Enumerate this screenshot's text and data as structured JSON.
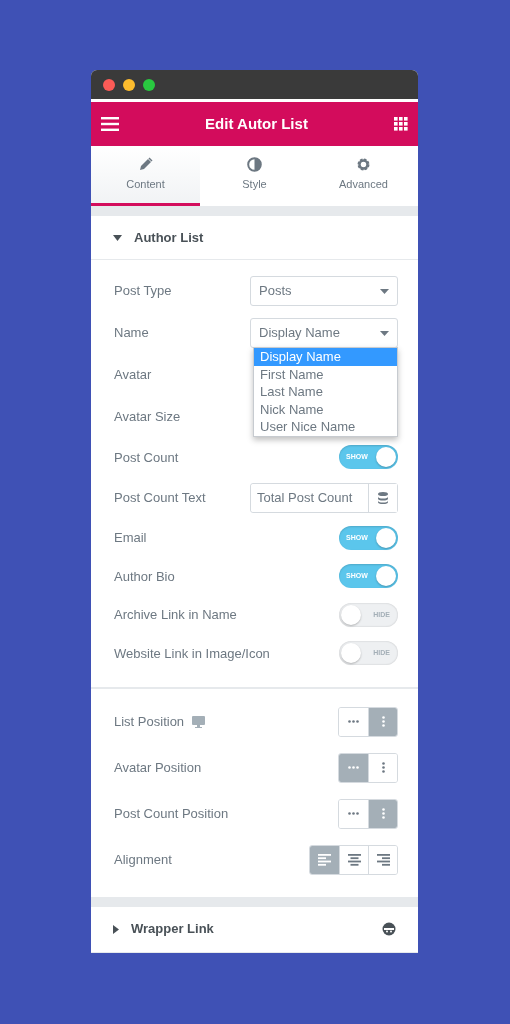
{
  "window": {
    "controls": [
      {
        "color": "#fc5b57"
      },
      {
        "color": "#fdbc2e"
      },
      {
        "color": "#29c940"
      }
    ]
  },
  "header": {
    "title": "Edit Autor List"
  },
  "tabs": [
    {
      "label": "Content",
      "selected": true
    },
    {
      "label": "Style",
      "selected": false
    },
    {
      "label": "Advanced",
      "selected": false
    }
  ],
  "sections": [
    {
      "title": "Author List",
      "expanded": true,
      "groups": [
        [
          {
            "kind": "select",
            "label": "Post Type",
            "value": "Posts"
          },
          {
            "kind": "select",
            "label": "Name",
            "value": "Display Name",
            "dropdown": [
              {
                "label": "Display Name",
                "selected": true
              },
              {
                "label": "First Name",
                "selected": false
              },
              {
                "label": "Last Name",
                "selected": false
              },
              {
                "label": "Nick Name",
                "selected": false
              },
              {
                "label": "User Nice Name",
                "selected": false
              }
            ]
          },
          {
            "kind": "label",
            "label": "Avatar"
          },
          {
            "kind": "label",
            "label": "Avatar Size"
          },
          {
            "kind": "toggle",
            "label": "Post Count",
            "on": true,
            "text": "SHOW"
          },
          {
            "kind": "text",
            "label": "Post Count Text",
            "value": "Total Post Count"
          },
          {
            "kind": "toggle",
            "label": "Email",
            "on": true,
            "text": "SHOW"
          },
          {
            "kind": "toggle",
            "label": "Author Bio",
            "on": true,
            "text": "SHOW"
          },
          {
            "kind": "toggle",
            "label": "Archive Link in Name",
            "on": false,
            "text": "HIDE"
          },
          {
            "kind": "toggle",
            "label": "Website Link in Image/Icon",
            "on": false,
            "text": "HIDE"
          }
        ],
        [
          {
            "kind": "choose",
            "label": "List Position",
            "responsive": true,
            "options": [
              {
                "kind": "horizontal",
                "selected": false
              },
              {
                "kind": "vertical",
                "selected": true
              }
            ]
          },
          {
            "kind": "choose",
            "label": "Avatar Position",
            "responsive": false,
            "options": [
              {
                "kind": "horizontal",
                "selected": true
              },
              {
                "kind": "vertical",
                "selected": false
              }
            ]
          },
          {
            "kind": "choose",
            "label": "Post Count Position",
            "responsive": false,
            "options": [
              {
                "kind": "horizontal",
                "selected": false
              },
              {
                "kind": "vertical",
                "selected": true
              }
            ]
          },
          {
            "kind": "choose",
            "label": "Alignment",
            "responsive": false,
            "options": [
              {
                "kind": "left",
                "selected": true
              },
              {
                "kind": "center",
                "selected": false
              },
              {
                "kind": "right",
                "selected": false
              }
            ]
          }
        ]
      ]
    },
    {
      "title": "Wrapper Link",
      "expanded": false
    }
  ]
}
